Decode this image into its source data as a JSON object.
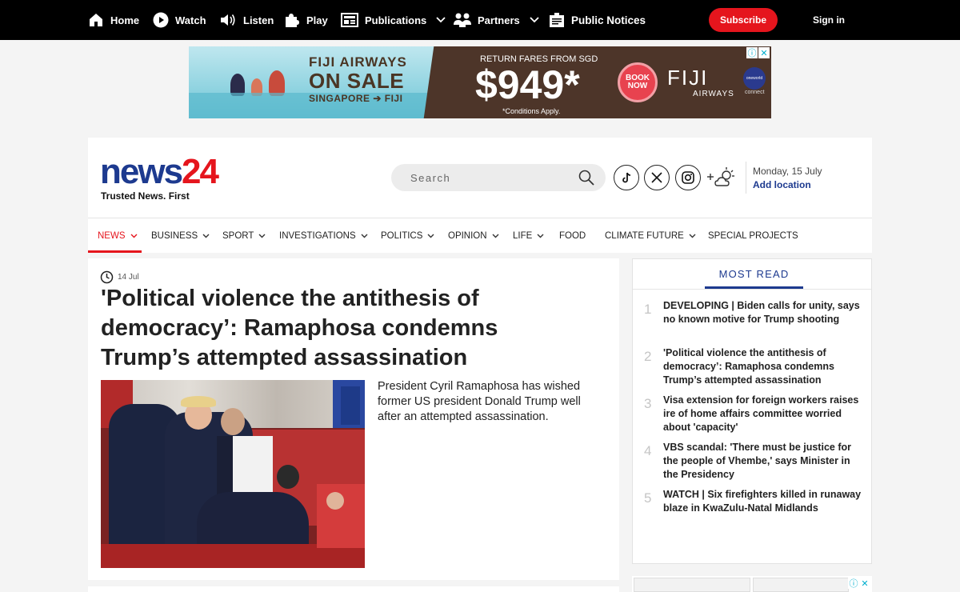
{
  "topnav": {
    "home": "Home",
    "watch": "Watch",
    "listen": "Listen",
    "play": "Play",
    "publications": "Publications",
    "partners": "Partners",
    "notices": "Public Notices",
    "subscribe": "Subscribe",
    "signin": "Sign in"
  },
  "ad": {
    "line1": "FIJI AIRWAYS",
    "line2": "ON SALE",
    "line3": "SINGAPORE ➔ FIJI",
    "fares": "RETURN FARES FROM SGD",
    "price": "$949*",
    "conditions": "*Conditions Apply.",
    "book": "BOOK NOW",
    "brand": "FIJI",
    "brand_sub": "AIRWAYS",
    "globe": "oneworld",
    "connect": "connect"
  },
  "header": {
    "logo_main": "news",
    "logo_num": "24",
    "tagline": "Trusted News. First",
    "search_placeholder": "Search",
    "date": "Monday, 15 July",
    "add_location": "Add location"
  },
  "nav": [
    "NEWS",
    "BUSINESS",
    "SPORT",
    "INVESTIGATIONS",
    "POLITICS",
    "OPINION",
    "LIFE",
    "FOOD",
    "CLIMATE FUTURE",
    "SPECIAL PROJECTS"
  ],
  "article": {
    "date": "14 Jul",
    "headline": "'Political violence the antithesis of democracy’: Ramaphosa condemns Trump’s attempted assassination",
    "summary": "President Cyril Ramaphosa has wished former US president Donald Trump well after an attempted assassination."
  },
  "most_read": {
    "title": "MOST READ",
    "items": [
      {
        "num": "1",
        "text": "DEVELOPING | Biden calls for unity, says no known motive for Trump shooting"
      },
      {
        "num": "2",
        "text": "'Political violence the antithesis of democracy’: Ramaphosa condemns Trump’s attempted assassination"
      },
      {
        "num": "3",
        "text": "Visa extension for foreign workers raises ire of home affairs committee worried about 'capacity'"
      },
      {
        "num": "4",
        "text": "VBS scandal: 'There must be justice for the people of Vhembe,' says Minister in the Presidency"
      },
      {
        "num": "5",
        "text": "WATCH | Six firefighters killed in runaway blaze in KwaZulu-Natal Midlands"
      }
    ]
  },
  "colors": {
    "brand_blue": "#1d3a8f",
    "brand_red": "#e5151d"
  }
}
